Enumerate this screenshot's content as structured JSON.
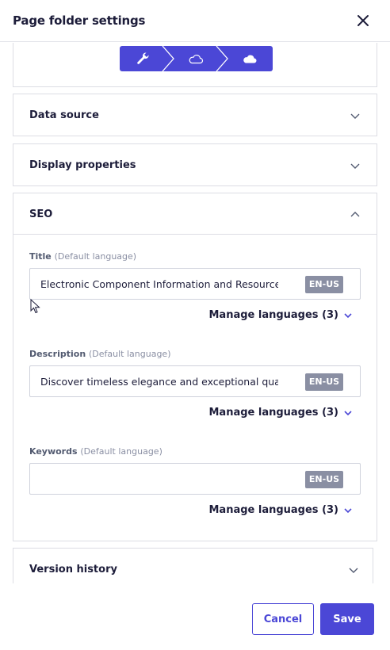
{
  "header": {
    "title": "Page folder settings"
  },
  "workflow": {
    "steps": [
      "wrench-icon",
      "cloud-outline-icon",
      "cloud-filled-icon"
    ]
  },
  "sections": {
    "data_source": {
      "title": "Data source"
    },
    "display_properties": {
      "title": "Display properties"
    },
    "seo": {
      "title": "SEO",
      "title_field": {
        "label": "Title",
        "sub": "(Default language)",
        "value": "Electronic Component Information and Resources |",
        "lang": "EN-US",
        "manage": "Manage languages (3)"
      },
      "description_field": {
        "label": "Description",
        "sub": "(Default language)",
        "value": "Discover timeless elegance and exceptional quality a",
        "lang": "EN-US",
        "manage": "Manage languages (3)"
      },
      "keywords_field": {
        "label": "Keywords",
        "sub": "(Default language)",
        "value": "",
        "lang": "EN-US",
        "manage": "Manage languages (3)"
      }
    },
    "version_history": {
      "title": "Version history"
    }
  },
  "footer": {
    "cancel_label": "Cancel",
    "save_label": "Save"
  },
  "colors": {
    "accent": "#4b47d6",
    "badge": "#8a8fa3",
    "border": "#dcdde4"
  }
}
